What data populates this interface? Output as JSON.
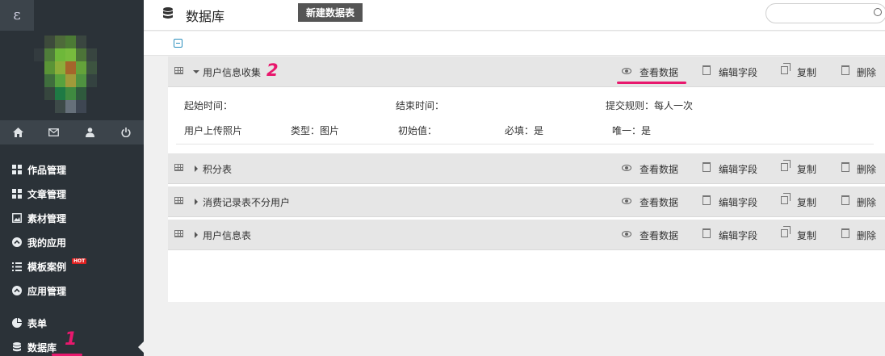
{
  "sidebar": {
    "logo": "ε",
    "quick_icons": [
      "home-icon",
      "mail-icon",
      "user-icon",
      "power-icon"
    ],
    "menu": [
      {
        "label": "作品管理",
        "icon": "grid-icon"
      },
      {
        "label": "文章管理",
        "icon": "grid-icon"
      },
      {
        "label": "素材管理",
        "icon": "image-icon"
      },
      {
        "label": "我的应用",
        "icon": "circle-up-icon"
      },
      {
        "label": "模板案例",
        "icon": "list-icon",
        "badge": "HOT"
      },
      {
        "label": "应用管理",
        "icon": "circle-up-icon"
      },
      {
        "label": "表单",
        "icon": "pie-chart-icon"
      },
      {
        "label": "数据库",
        "icon": "database-icon",
        "active": true
      }
    ],
    "annotation": "1"
  },
  "header": {
    "title": "数据库",
    "new_button": "新建数据表",
    "search_placeholder": ""
  },
  "tables": [
    {
      "name": "用户信息收集",
      "expanded": true
    },
    {
      "name": "积分表",
      "expanded": false
    },
    {
      "name": "消费记录表不分用户",
      "expanded": false
    },
    {
      "name": "用户信息表",
      "expanded": false
    }
  ],
  "actions": {
    "view": "查看数据",
    "edit": "编辑字段",
    "copy": "复制",
    "delete": "删除"
  },
  "detail": {
    "start_time": "起始时间：",
    "end_time": "结束时间：",
    "rule": "提交规则：每人一次",
    "field": {
      "name": "用户上传照片",
      "type": "类型：图片",
      "initial": "初始值：",
      "required": "必填：是",
      "unique": "唯一：是"
    }
  },
  "annotation_2": "2",
  "colors": {
    "sidebar": "#2b3238",
    "accent": "#e8186d",
    "button": "#555555"
  }
}
